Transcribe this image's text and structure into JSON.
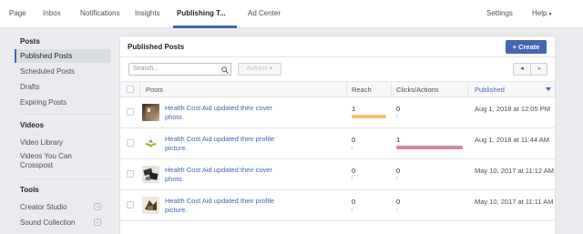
{
  "topnav": {
    "items": [
      {
        "label": "Page"
      },
      {
        "label": "Inbox"
      },
      {
        "label": "Notifications"
      },
      {
        "label": "Insights"
      },
      {
        "label": "Publishing T...",
        "active": true
      },
      {
        "label": "Ad Center"
      }
    ],
    "settings": "Settings",
    "help": "Help"
  },
  "sidebar": {
    "posts_title": "Posts",
    "posts": [
      {
        "label": "Published Posts",
        "active": true
      },
      {
        "label": "Scheduled Posts"
      },
      {
        "label": "Drafts"
      },
      {
        "label": "Expiring Posts"
      }
    ],
    "videos_title": "Videos",
    "videos": [
      {
        "label": "Video Library"
      },
      {
        "label": "Videos You Can Crosspost"
      }
    ],
    "tools_title": "Tools",
    "tools": [
      {
        "label": "Creator Studio",
        "icon": "external-link-icon"
      },
      {
        "label": "Sound Collection",
        "icon": "external-link-icon"
      }
    ]
  },
  "panel": {
    "title": "Published Posts",
    "create_label": "+ Create",
    "search_placeholder": "Search...",
    "actions_label": "Actions ▾",
    "pager_prev": "◂",
    "pager_next": "▸",
    "columns": {
      "posts": "Posts",
      "reach": "Reach",
      "clicks": "Clicks/Actions",
      "published": "Published"
    },
    "rows": [
      {
        "text": "Health Cost Aid updated their cover photo.",
        "thumb": "cover-photo-thumbnail",
        "reach": "1",
        "clicks": "0",
        "reach_fraction": 1.0,
        "clicks_fraction": 0,
        "published": "Aug 1, 2018 at 12:05 PM"
      },
      {
        "text": "Health Cost Aid updated their profile picture.",
        "thumb": "profile-picture-thumbnail",
        "reach": "0",
        "clicks": "1",
        "reach_fraction": 0,
        "clicks_fraction": 1.0,
        "published": "Aug 1, 2018 at 11:44 AM"
      },
      {
        "text": "Health Cost Aid updated their cover photo.",
        "thumb": "cover-photo-thumbnail",
        "reach": "0",
        "clicks": "0",
        "reach_fraction": 0,
        "clicks_fraction": 0,
        "published": "May 10, 2017 at 11:12 AM"
      },
      {
        "text": "Health Cost Aid updated their profile picture.",
        "thumb": "profile-picture-thumbnail",
        "reach": "0",
        "clicks": "0",
        "reach_fraction": 0,
        "clicks_fraction": 0,
        "published": "May 10, 2017 at 11:11 AM"
      }
    ]
  },
  "colors": {
    "accent": "#4267b2",
    "reach_bar": "#f7c07a",
    "clicks_bar": "#d48a9c"
  }
}
